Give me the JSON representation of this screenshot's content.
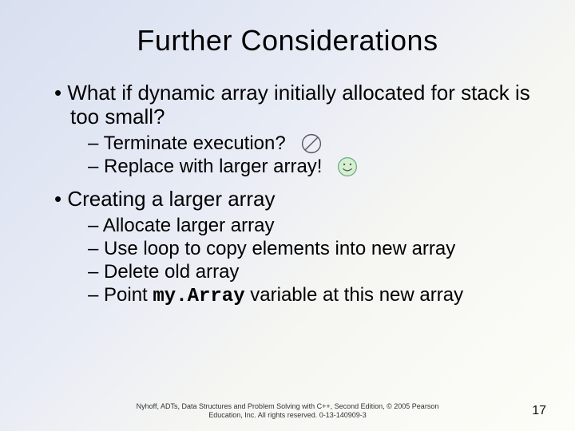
{
  "title": "Further Considerations",
  "b1": "What if dynamic array initially allocated for stack is too small?",
  "b1a": "Terminate execution?",
  "b1b": "Replace with larger array!",
  "b2": "Creating a larger array",
  "b2a": "Allocate larger array",
  "b2b": "Use loop to copy elements into new array",
  "b2c": "Delete old array",
  "b2d_pre": "Point ",
  "b2d_code": "my.Array",
  "b2d_post": " variable at this new array",
  "footer_line1": "Nyhoff, ADTs, Data Structures and Problem Solving with C++, Second Edition, © 2005 Pearson",
  "footer_line2": "Education, Inc. All rights reserved. 0-13-140909-3",
  "page_number": "17",
  "icons": {
    "no": "no-symbol-icon",
    "smile": "smiley-icon"
  }
}
